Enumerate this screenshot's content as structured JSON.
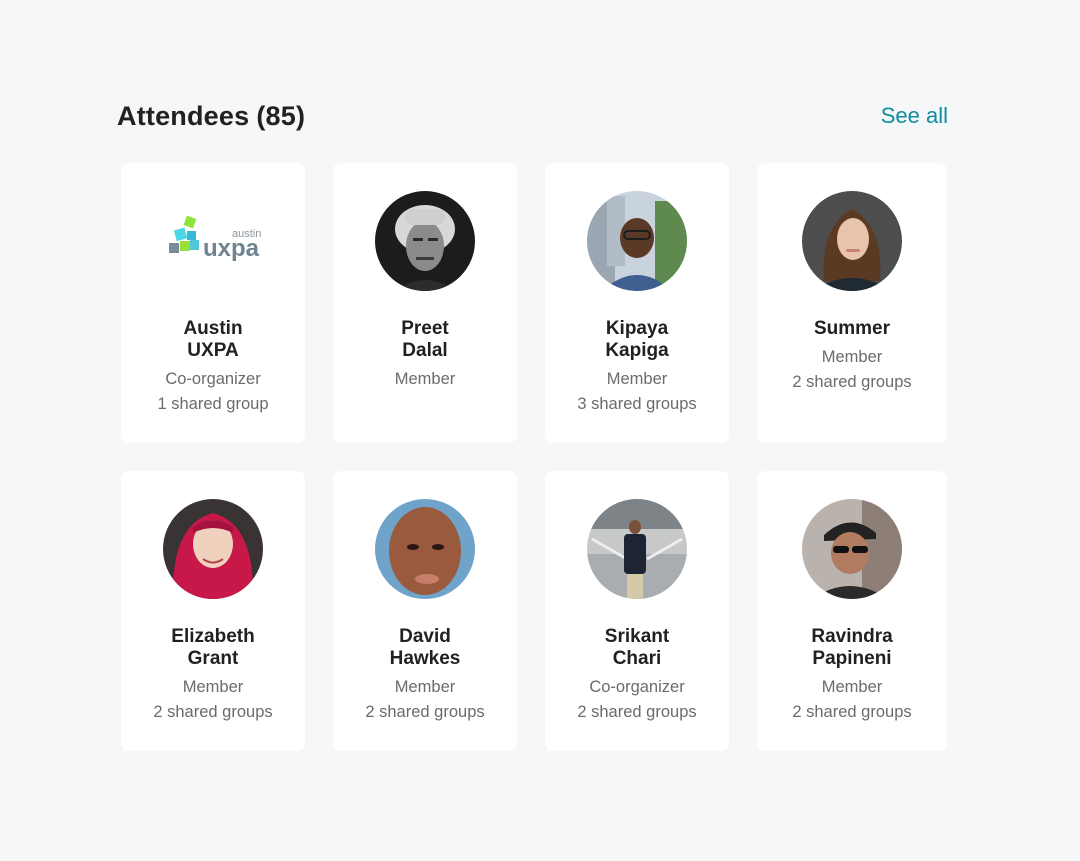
{
  "header": {
    "title": "Attendees",
    "count": "(85)",
    "see_all": "See all"
  },
  "attendees": [
    {
      "first": "Austin",
      "last": "UXPA",
      "role": "Co-organizer",
      "shared": "1 shared group",
      "logo_small": "austin",
      "logo_big": "uxpa"
    },
    {
      "first": "Preet",
      "last": "Dalal",
      "role": "Member",
      "shared": ""
    },
    {
      "first": "Kipaya",
      "last": "Kapiga",
      "role": "Member",
      "shared": "3 shared groups"
    },
    {
      "first": "Summer",
      "last": "",
      "role": "Member",
      "shared": "2 shared groups"
    },
    {
      "first": "Elizabeth",
      "last": "Grant",
      "role": "Member",
      "shared": "2 shared groups"
    },
    {
      "first": "David",
      "last": "Hawkes",
      "role": "Member",
      "shared": "2 shared groups"
    },
    {
      "first": "Srikant",
      "last": "Chari",
      "role": "Co-organizer",
      "shared": "2 shared groups"
    },
    {
      "first": "Ravindra",
      "last": "Papineni",
      "role": "Member",
      "shared": "2 shared groups"
    }
  ],
  "colors": {
    "accent": "#0f8ea0",
    "background": "#f6f7f8",
    "card": "#ffffff",
    "text_primary": "#212121",
    "text_secondary": "#6b6b6b"
  }
}
